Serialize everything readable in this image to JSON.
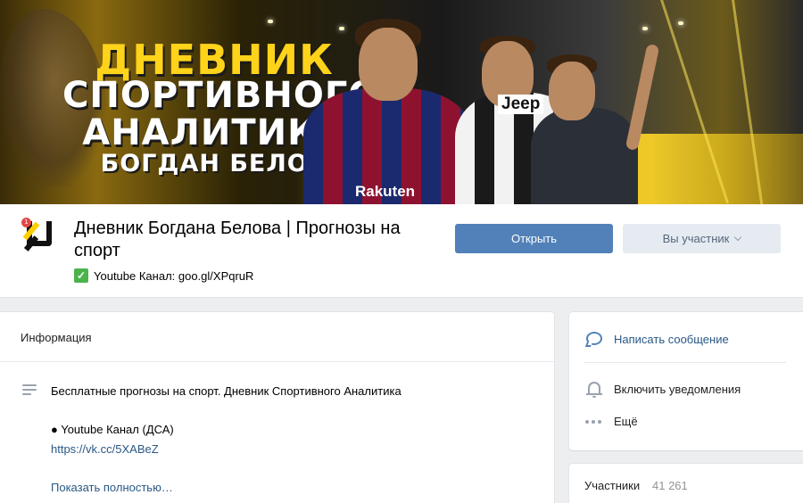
{
  "cover": {
    "line1": "Дневник",
    "line2": "Спортивного",
    "line3": "Аналитика",
    "line4": "Богдан Белов",
    "sponsor1": "Rakuten",
    "sponsor2": "Jeep"
  },
  "header": {
    "title": "Дневник Богдана Белова | Прогнозы на спорт",
    "status": "Youtube Канал: goo.gl/XPqruR",
    "open_button": "Открыть",
    "member_button": "Вы участник"
  },
  "info": {
    "title": "Информация",
    "description": "Бесплатные прогнозы на спорт. Дневник Спортивного Аналитика",
    "youtube_line": "● Youtube Канал (ДСА)",
    "youtube_link": "https://vk.cc/5XABeZ",
    "show_more": "Показать полностью…"
  },
  "actions": {
    "message": "Написать сообщение",
    "notifications": "Включить уведомления",
    "more": "Ещё"
  },
  "members": {
    "label": "Участники",
    "count": "41 261"
  },
  "colors": {
    "accent": "#5181b8",
    "link": "#2a5885",
    "verified": "#4bb34b",
    "cover_yellow": "#ffd31a"
  }
}
